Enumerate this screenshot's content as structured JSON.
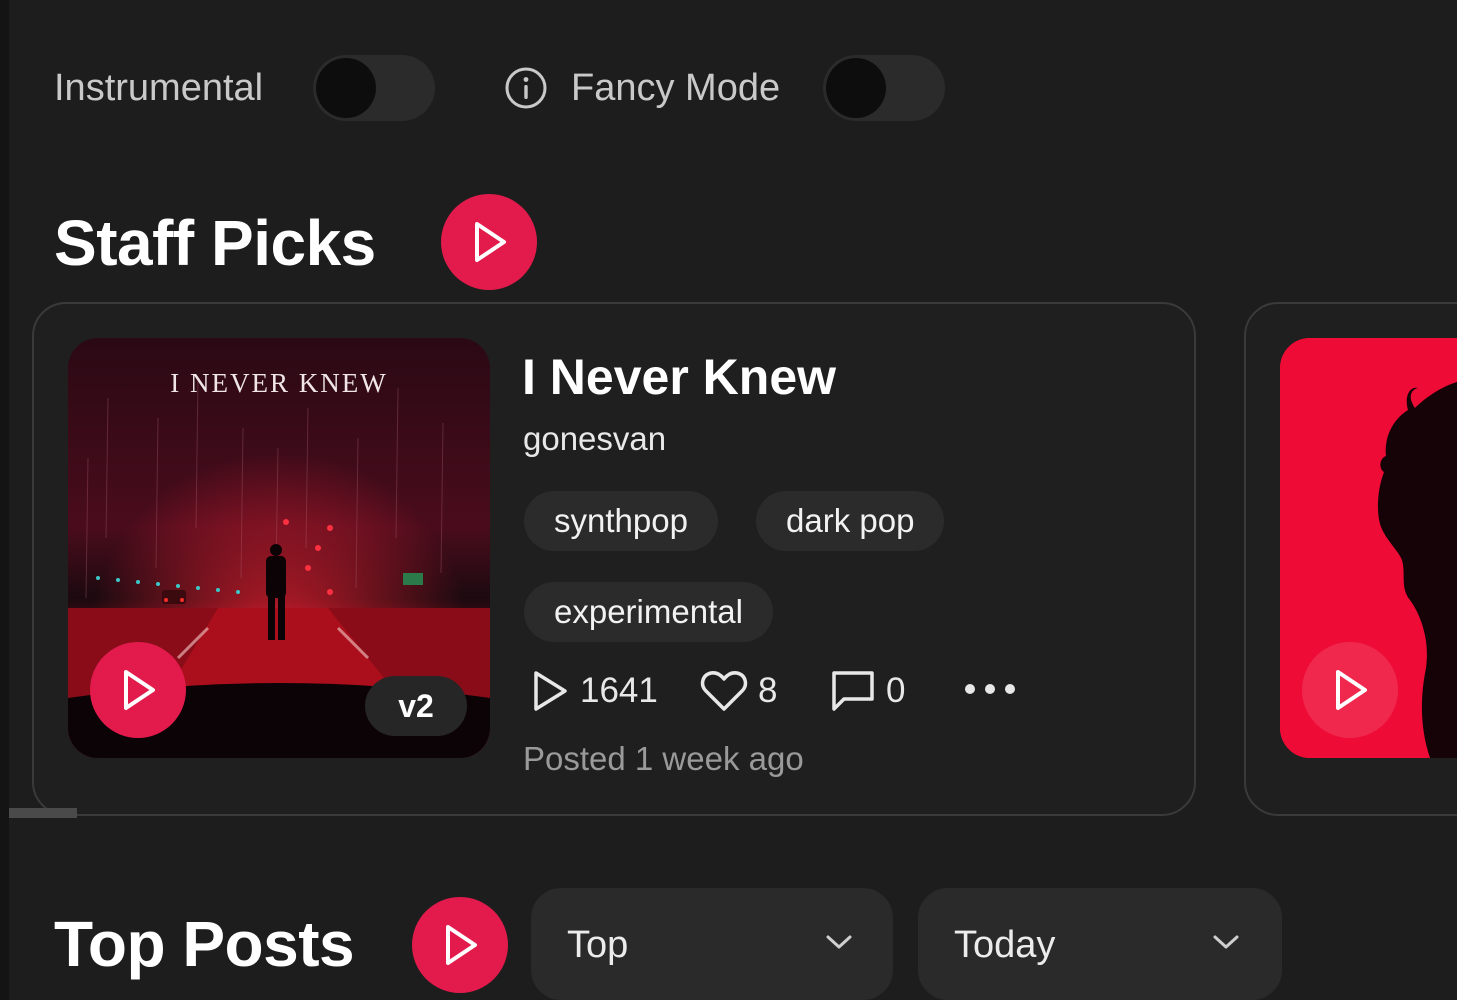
{
  "toggles": {
    "instrumental": {
      "label": "Instrumental",
      "on": false
    },
    "fancy_mode": {
      "label": "Fancy Mode",
      "on": false,
      "icon": "info-icon"
    }
  },
  "staff_picks": {
    "title": "Staff Picks",
    "play_icon": "play-icon",
    "cards": [
      {
        "cover_text": "I NEVER KNEW",
        "version": "v2",
        "title": "I Never Knew",
        "artist": "gonesvan",
        "tags": [
          "synthpop",
          "dark pop",
          "experimental"
        ],
        "plays": "1641",
        "likes": "8",
        "comments": "0",
        "more_icon": "more-horizontal-icon",
        "posted": "Posted 1 week ago"
      }
    ]
  },
  "top_posts": {
    "title": "Top Posts",
    "sort_select": {
      "value": "Top"
    },
    "period_select": {
      "value": "Today"
    }
  },
  "colors": {
    "accent": "#e21b4c",
    "background": "#1d1d1d",
    "surface": "#2b2b2b"
  }
}
